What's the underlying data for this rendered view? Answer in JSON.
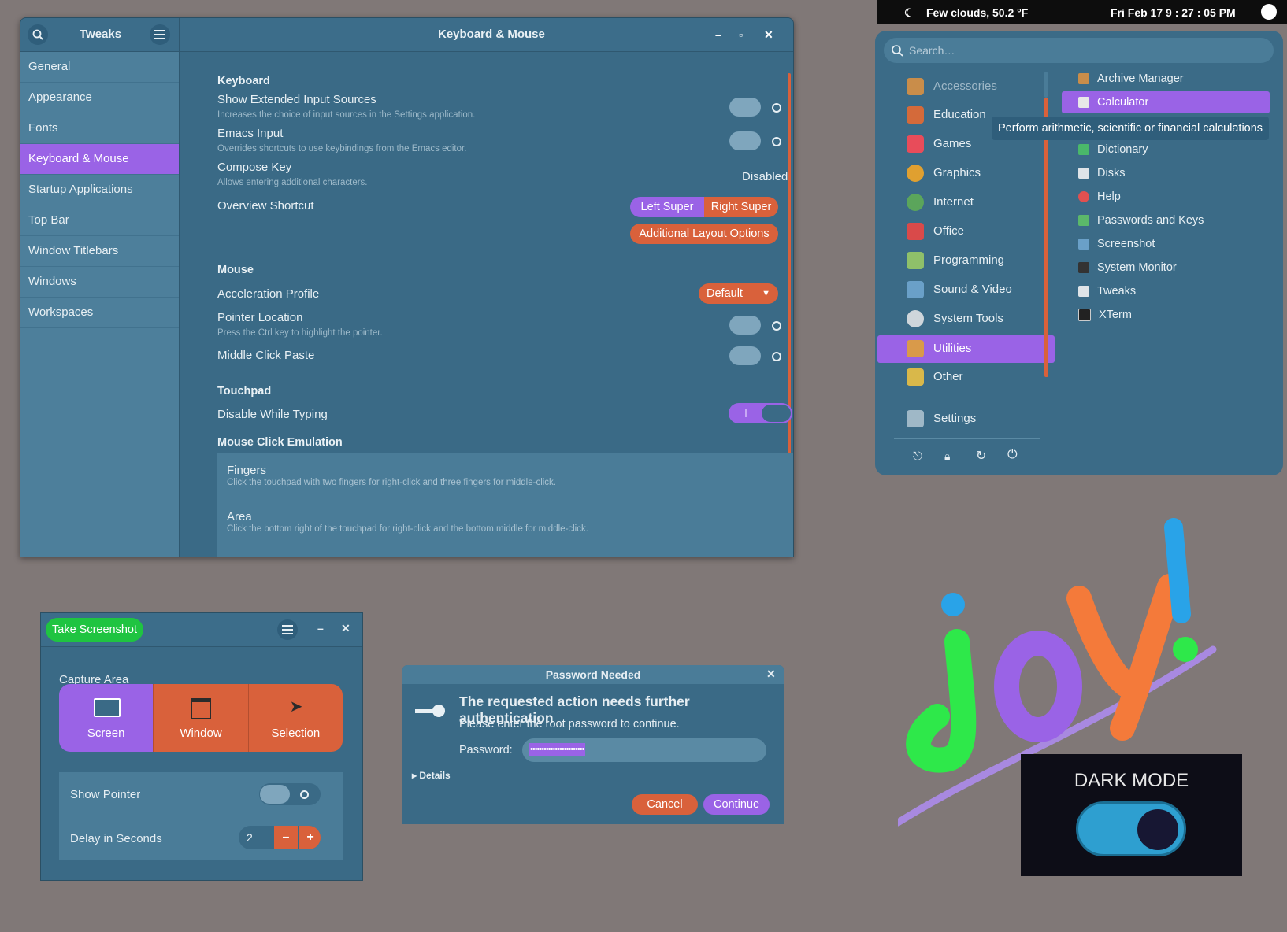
{
  "tweaks": {
    "title": "Tweaks",
    "window_title": "Keyboard & Mouse",
    "sidebar": [
      {
        "label": "General"
      },
      {
        "label": "Appearance"
      },
      {
        "label": "Fonts"
      },
      {
        "label": "Keyboard & Mouse"
      },
      {
        "label": "Startup Applications"
      },
      {
        "label": "Top Bar"
      },
      {
        "label": "Window Titlebars"
      },
      {
        "label": "Windows"
      },
      {
        "label": "Workspaces"
      }
    ],
    "keyboard": {
      "section": "Keyboard",
      "ext_title": "Show Extended Input Sources",
      "ext_desc": "Increases the choice of input sources in the Settings application.",
      "emacs_title": "Emacs Input",
      "emacs_desc": "Overrides shortcuts to use keybindings from the Emacs editor.",
      "compose_title": "Compose Key",
      "compose_desc": "Allows entering additional characters.",
      "compose_value": "Disabled",
      "overview_title": "Overview Shortcut",
      "left_super": "Left Super",
      "right_super": "Right Super",
      "layout_options": "Additional Layout Options"
    },
    "mouse": {
      "section": "Mouse",
      "accel_title": "Acceleration Profile",
      "accel_value": "Default",
      "pointer_title": "Pointer Location",
      "pointer_desc": "Press the Ctrl key to highlight the pointer.",
      "middle_title": "Middle Click Paste"
    },
    "touchpad": {
      "section": "Touchpad",
      "disable_title": "Disable While Typing"
    },
    "emulation": {
      "section": "Mouse Click Emulation",
      "fingers_title": "Fingers",
      "fingers_desc": "Click the touchpad with two fingers for right-click and three fingers for middle-click.",
      "area_title": "Area",
      "area_desc": "Click the bottom right of the touchpad for right-click and the bottom middle for middle-click."
    }
  },
  "topbar": {
    "weather": "Few clouds, 50.2 °F",
    "clock": "Fri Feb 17   9 : 27 : 05 PM"
  },
  "menu": {
    "search_placeholder": "Search…",
    "categories": [
      {
        "label": "Accessories"
      },
      {
        "label": "Education"
      },
      {
        "label": "Games"
      },
      {
        "label": "Graphics"
      },
      {
        "label": "Internet"
      },
      {
        "label": "Office"
      },
      {
        "label": "Programming"
      },
      {
        "label": "Sound & Video"
      },
      {
        "label": "System Tools"
      },
      {
        "label": "Utilities"
      },
      {
        "label": "Other"
      }
    ],
    "settings": "Settings",
    "apps": [
      {
        "label": "Archive Manager"
      },
      {
        "label": "Calculator"
      },
      {
        "label": "Dictionary"
      },
      {
        "label": "Disks"
      },
      {
        "label": "Help"
      },
      {
        "label": "Passwords and Keys"
      },
      {
        "label": "Screenshot"
      },
      {
        "label": "System Monitor"
      },
      {
        "label": "Tweaks"
      },
      {
        "label": "XTerm"
      }
    ],
    "tooltip": "Perform arithmetic, scientific or financial calculations"
  },
  "screenshot": {
    "take": "Take Screenshot",
    "capture_area": "Capture Area",
    "screen": "Screen",
    "window": "Window",
    "selection": "Selection",
    "show_pointer": "Show Pointer",
    "delay": "Delay in Seconds",
    "delay_value": "2"
  },
  "password": {
    "title": "Password Needed",
    "heading": "The requested action needs further authentication",
    "sub": "Please enter the root password to continue.",
    "label": "Password:",
    "mask": "••••••••••••••••••••••••",
    "details": "Details",
    "cancel": "Cancel",
    "continue": "Continue"
  },
  "art": {
    "joy": "JOY!",
    "darkmode": "DARK MODE"
  },
  "colors": {
    "accent": "#9a63e6",
    "orange": "#d9613b",
    "panel": "#3a6a86"
  }
}
